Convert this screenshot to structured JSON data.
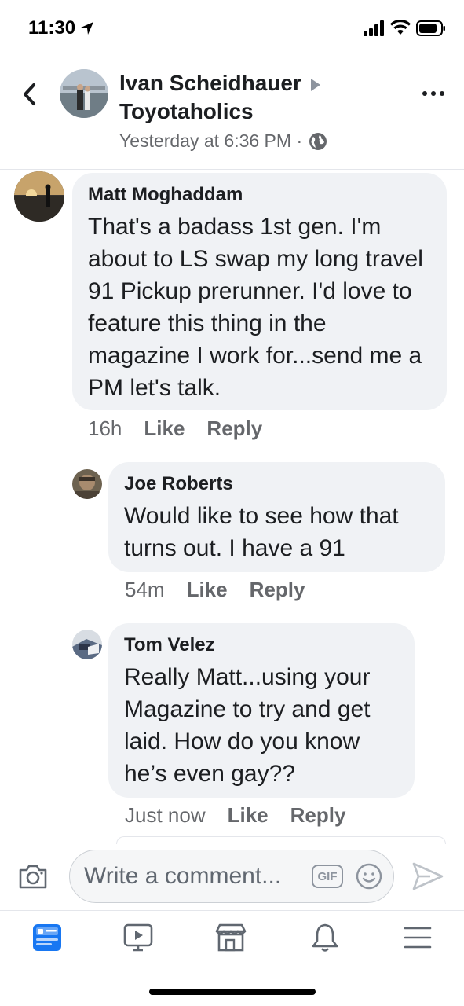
{
  "status_bar": {
    "time": "11:30"
  },
  "header": {
    "author": "Ivan Scheidhauer",
    "group": "Toyotaholics",
    "timestamp": "Yesterday at 6:36 PM ·"
  },
  "comments": [
    {
      "name": "Matt Moghaddam",
      "text": "That's a badass 1st gen. I'm about to LS swap my long travel 91 Pickup prerunner. I'd love to feature this thing in the magazine I work for...send me a PM let's talk.",
      "time": "16h",
      "like": "Like",
      "reply": "Reply"
    },
    {
      "name": "Joe Roberts",
      "text": "Would like to see how that turns out. I have a 91",
      "time": "54m",
      "like": "Like",
      "reply": "Reply"
    },
    {
      "name": "Tom Velez",
      "text": "Really Matt...using your Magazine to try and get laid. How do you know he’s even gay??",
      "time": "Just now",
      "like": "Like",
      "reply": "Reply"
    }
  ],
  "composer": {
    "placeholder": "Write a comment...",
    "gif_label": "GIF"
  },
  "colors": {
    "accent": "#1877f2",
    "bubble": "#f0f2f5",
    "meta": "#65676b"
  },
  "tabs": [
    "news-feed-icon",
    "watch-icon",
    "marketplace-icon",
    "notifications-icon",
    "menu-icon"
  ]
}
